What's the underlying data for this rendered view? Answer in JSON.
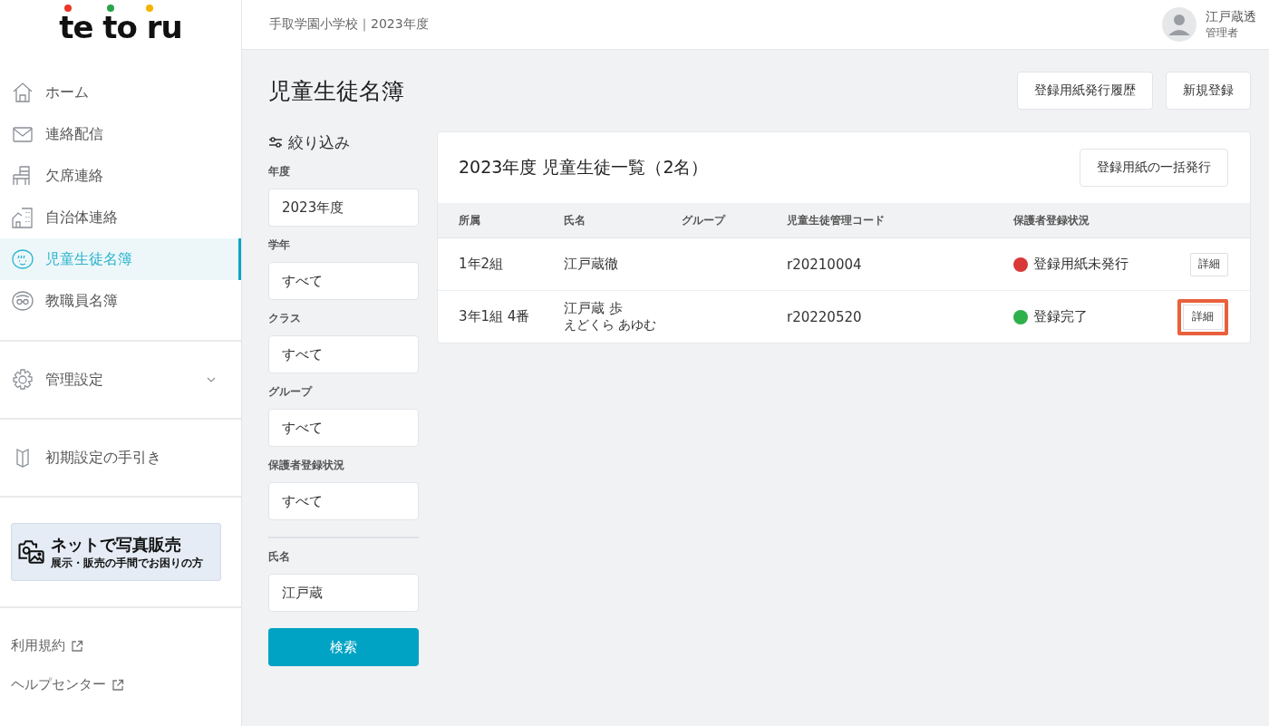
{
  "logo": {
    "text": "te to ru"
  },
  "sidebar": {
    "items": [
      {
        "label": "ホーム",
        "kind": "home",
        "selected": false
      },
      {
        "label": "連絡配信",
        "kind": "mail",
        "selected": false
      },
      {
        "label": "欠席連絡",
        "kind": "absence",
        "selected": false
      },
      {
        "label": "自治体連絡",
        "kind": "municipality",
        "selected": false
      },
      {
        "label": "児童生徒名簿",
        "kind": "students",
        "selected": true
      },
      {
        "label": "教職員名簿",
        "kind": "staff",
        "selected": false
      }
    ],
    "settings": {
      "label": "管理設定",
      "expanded": false
    },
    "guide": {
      "label": "初期設定の手引き"
    },
    "banner": {
      "title": "ネットで写真販売",
      "subtitle": "展示・販売の手間でお困りの方"
    },
    "links": [
      {
        "label": "利用規約"
      },
      {
        "label": "ヘルプセンター"
      }
    ]
  },
  "header": {
    "school": "手取学園小学校｜2023年度",
    "user_name": "江戸蔵透",
    "user_role": "管理者"
  },
  "page": {
    "title": "児童生徒名簿",
    "buttons": [
      "登録用紙発行履歴",
      "新規登録"
    ]
  },
  "filter": {
    "title": "絞り込み",
    "fields": [
      {
        "label": "年度",
        "value": "2023年度"
      },
      {
        "label": "学年",
        "value": "すべて"
      },
      {
        "label": "クラス",
        "value": "すべて"
      },
      {
        "label": "グループ",
        "value": "すべて"
      },
      {
        "label": "保護者登録状況",
        "value": "すべて"
      }
    ],
    "name_field": {
      "label": "氏名",
      "value": "江戸蔵"
    },
    "search_button": "検索"
  },
  "table": {
    "title": "2023年度 児童生徒一覧（2名）",
    "bulk_button": "登録用紙の一括発行",
    "columns": [
      "所属",
      "氏名",
      "グループ",
      "児童生徒管理コード",
      "保護者登録状況"
    ],
    "rows": [
      {
        "affiliation": "1年2組",
        "name": "江戸蔵徹",
        "code": "r20210004",
        "status": "登録用紙未発行",
        "color": "#d93838",
        "action": "詳細",
        "highlighted": false
      },
      {
        "affiliation": "3年1組 4番",
        "name": "江戸蔵 歩",
        "kana": "えどくら あゆむ",
        "code": "r20220520",
        "status": "登録完了",
        "color": "#2fb04a",
        "action": "詳細",
        "highlighted": true
      }
    ]
  }
}
